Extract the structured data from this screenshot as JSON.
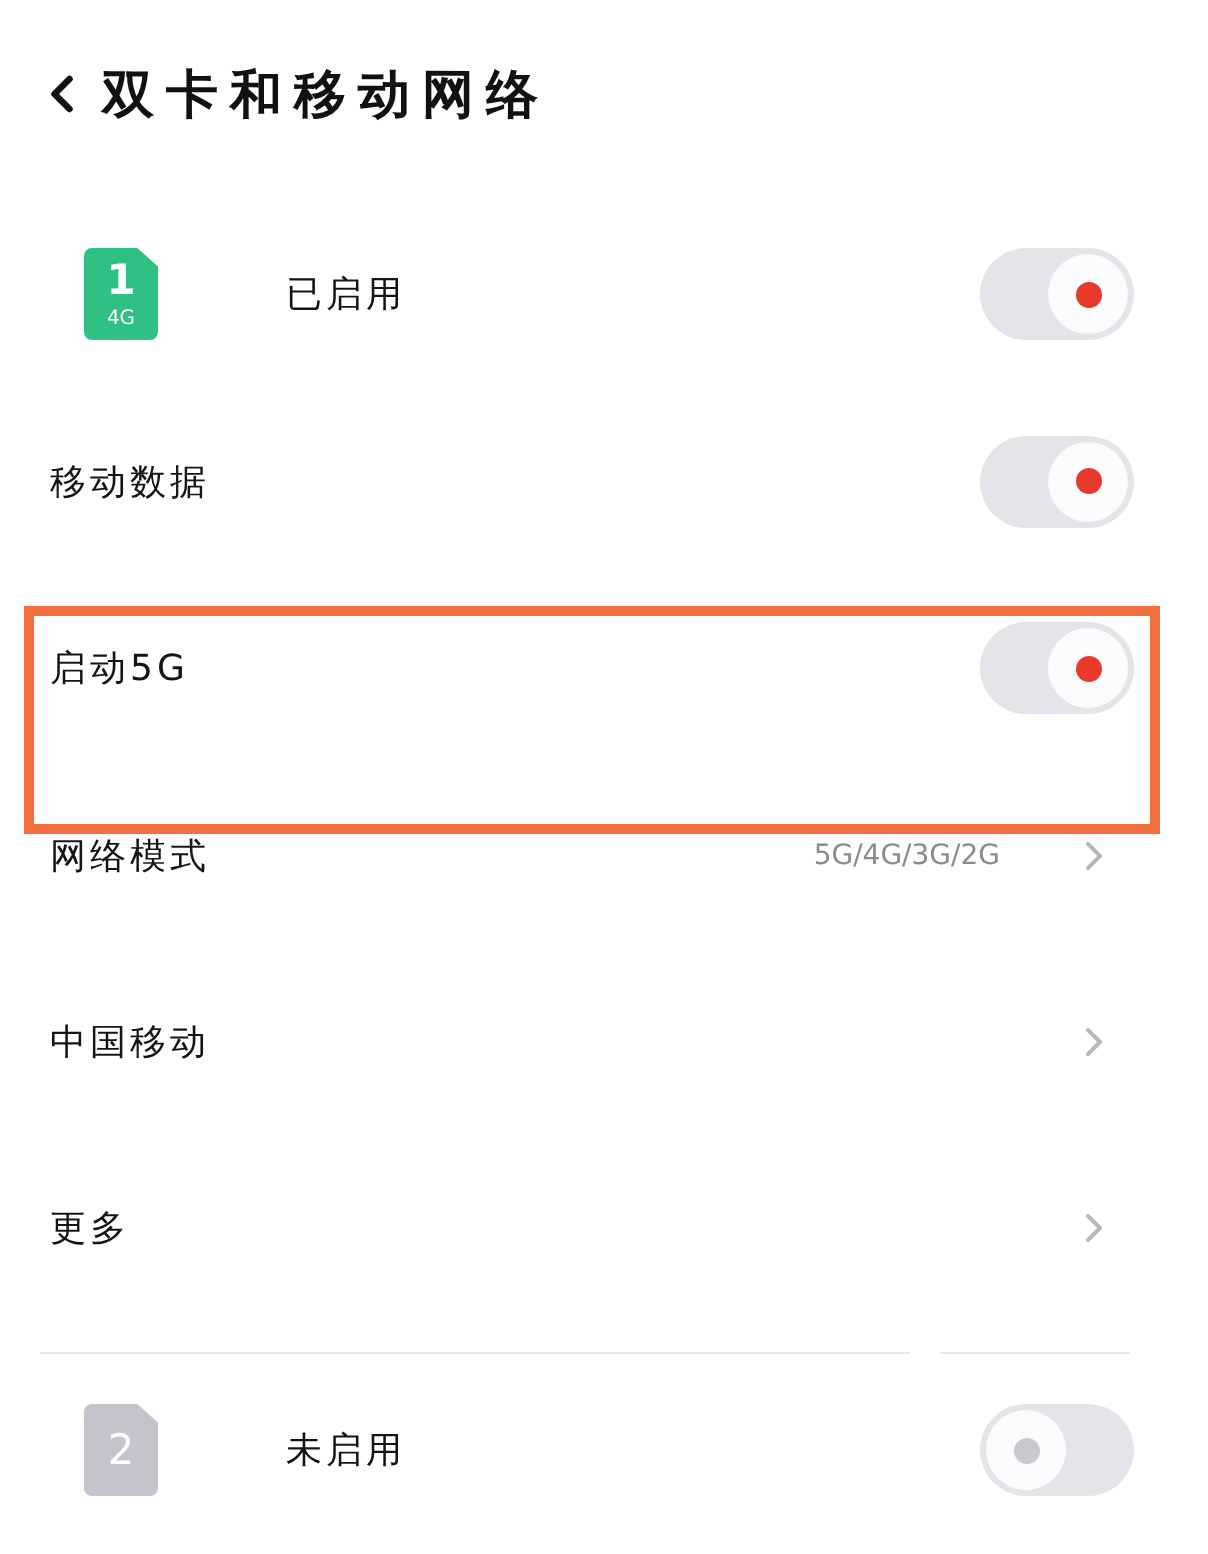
{
  "header": {
    "title": "双卡和移动网络"
  },
  "sim_cards": [
    {
      "number": "1",
      "network_type": "4G",
      "status": "已启用",
      "on": true,
      "settings": [
        {
          "kind": "toggle",
          "label": "移动数据",
          "on": true
        },
        {
          "kind": "toggle",
          "label": "启动5G",
          "on": true,
          "highlighted": true
        },
        {
          "kind": "link",
          "label": "网络模式",
          "value": "5G/4G/3G/2G"
        },
        {
          "kind": "link",
          "label": "中国移动"
        },
        {
          "kind": "link",
          "label": "更多"
        }
      ]
    },
    {
      "number": "2",
      "status": "未启用",
      "on": false
    }
  ]
}
